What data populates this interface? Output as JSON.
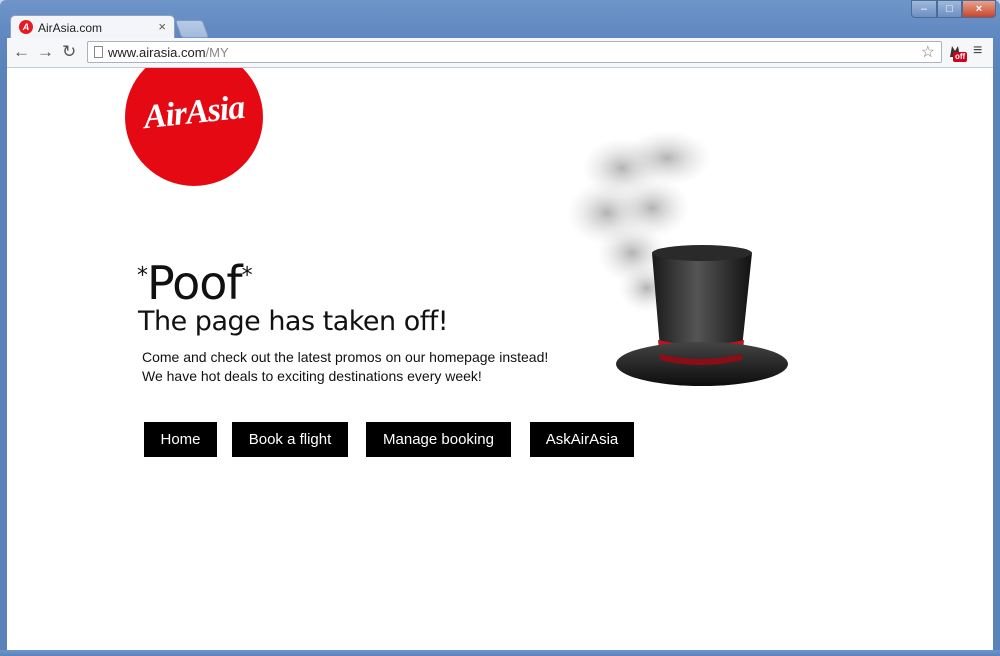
{
  "browser": {
    "tab": {
      "title": "AirAsia.com",
      "close": "×"
    },
    "window_controls": {
      "minimize": "–",
      "maximize": "□",
      "close": "×"
    },
    "address": {
      "host": "www.airasia.com",
      "path": "/MY"
    },
    "extension_badge": "off"
  },
  "page": {
    "logo_text": "AirAsia",
    "headline_star_left": "*",
    "headline_word": "Poof",
    "headline_star_right": "*",
    "subtitle": "The page has taken off!",
    "body_lines": [
      "Come and check out the latest promos on our homepage instead!",
      "We have hot deals to exciting destinations every week!"
    ],
    "buttons": {
      "home": "Home",
      "book": "Book a flight",
      "manage": "Manage booking",
      "ask": "AskAirAsia"
    }
  },
  "colors": {
    "brand_red": "#e50914",
    "button_bg": "#000000"
  }
}
